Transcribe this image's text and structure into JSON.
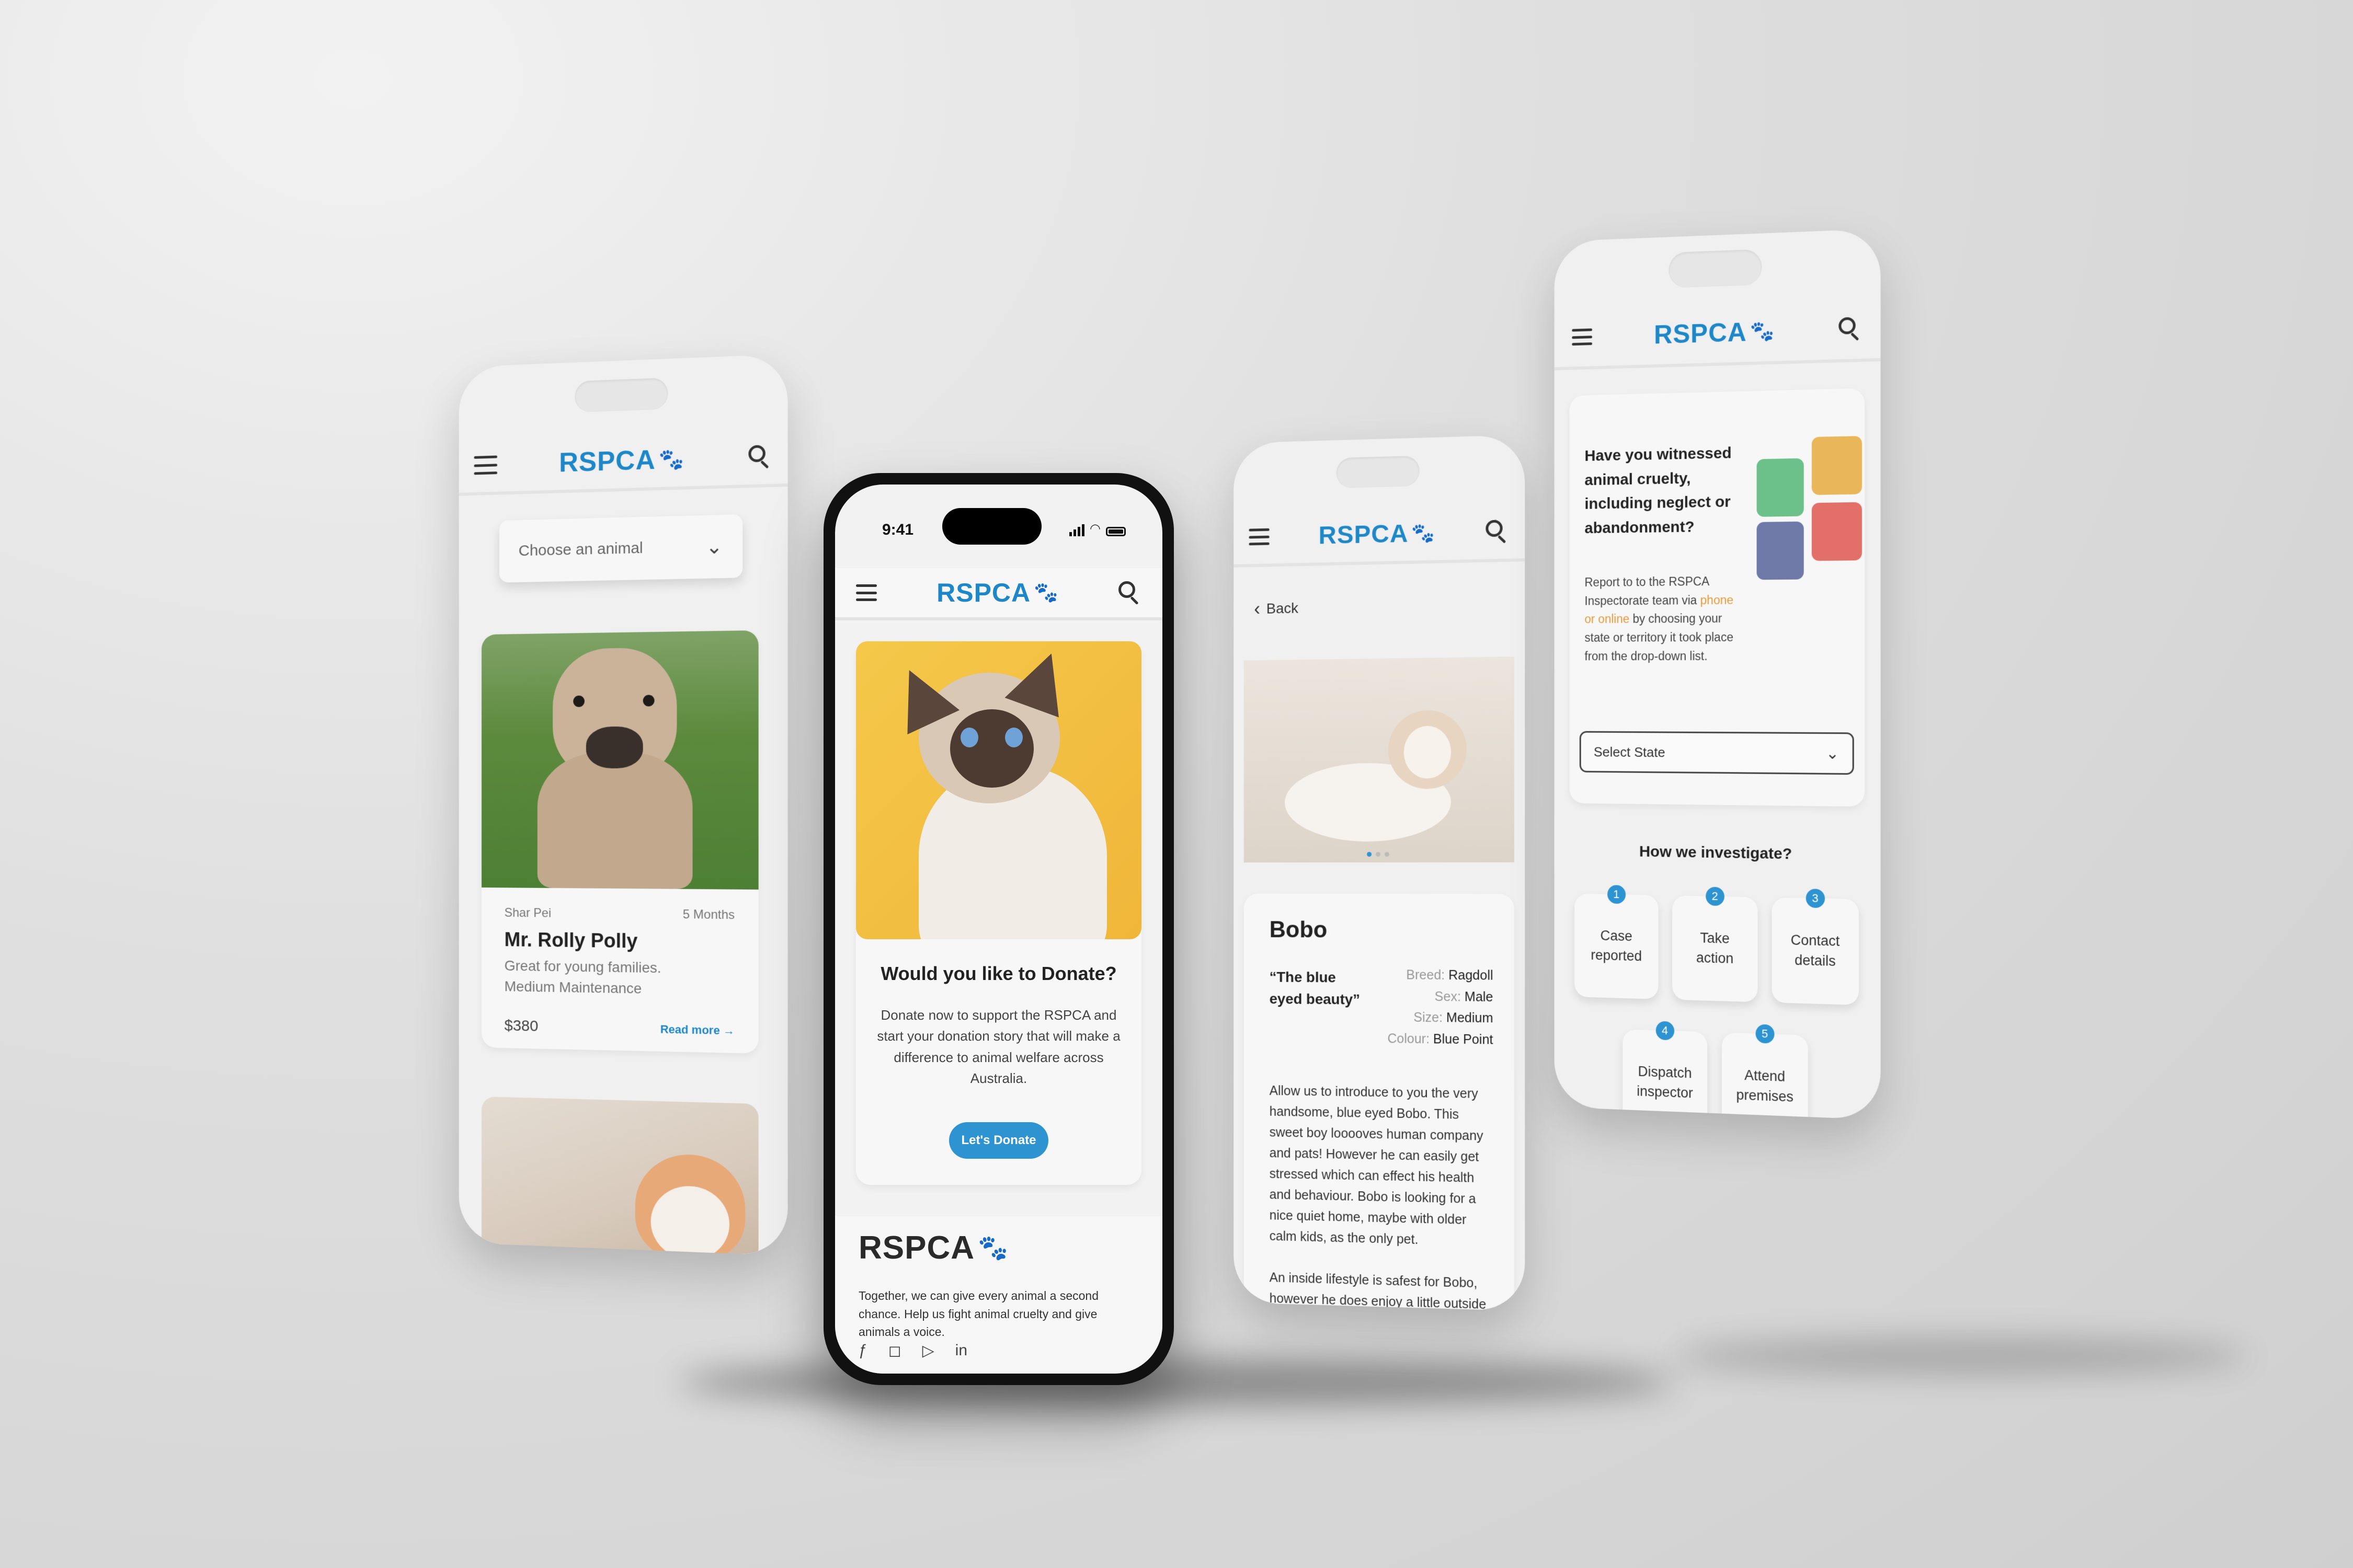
{
  "colors": {
    "brand_blue": "#1d87c7",
    "paw_green": "#5fbe7a",
    "button_blue": "#2e93d1",
    "link_orange": "#e59a3a"
  },
  "common": {
    "logo_text": "RSPCA"
  },
  "screen1": {
    "select_placeholder": "Choose an animal",
    "pet": {
      "breed": "Shar Pei",
      "age": "5 Months",
      "name": "Mr. Rolly Polly",
      "desc1": "Great for young families.",
      "desc2": "Medium Maintenance",
      "price": "$380",
      "read_more": "Read more →"
    }
  },
  "screen2": {
    "time": "9:41",
    "donate_title": "Would you like to Donate?",
    "donate_body": "Donate now to support the RSPCA and start your donation story that will make a difference to animal welfare across Australia.",
    "donate_button": "Let's Donate",
    "footer_text": "Together, we can give every animal a second chance. Help us fight animal cruelty and give animals a voice."
  },
  "screen3": {
    "back": "Back",
    "name": "Bobo",
    "quote": "“The blue eyed beauty”",
    "details": [
      {
        "label": "Breed:",
        "value": "Ragdoll"
      },
      {
        "label": "Sex:",
        "value": "Male"
      },
      {
        "label": "Size:",
        "value": "Medium"
      },
      {
        "label": "Colour:",
        "value": "Blue Point"
      }
    ],
    "body1": "Allow us to introduce to you the very handsome, blue eyed Bobo. This sweet boy looooves human company and pats! However he can easily get stressed which can effect his health and behaviour. Bobo is looking for a nice quiet home, maybe with older calm kids, as the only pet.",
    "body2": "An inside lifestyle is safest for Bobo, however he does enjoy a little outside"
  },
  "screen4": {
    "question": "Have you witnessed animal cruelty, including neglect or abandonment?",
    "report_pre": "Report to to the RSPCA Inspectorate team via",
    "report_link": "phone or online",
    "report_post": "by choosing your state or territory it took place from the drop-down list.",
    "select_state": "Select State",
    "investigate_title": "How we investigate?",
    "steps": [
      {
        "num": "1",
        "label": "Case reported"
      },
      {
        "num": "2",
        "label": "Take action"
      },
      {
        "num": "3",
        "label": "Contact details"
      },
      {
        "num": "4",
        "label": "Dispatch inspector"
      },
      {
        "num": "5",
        "label": "Attend premises"
      }
    ]
  }
}
